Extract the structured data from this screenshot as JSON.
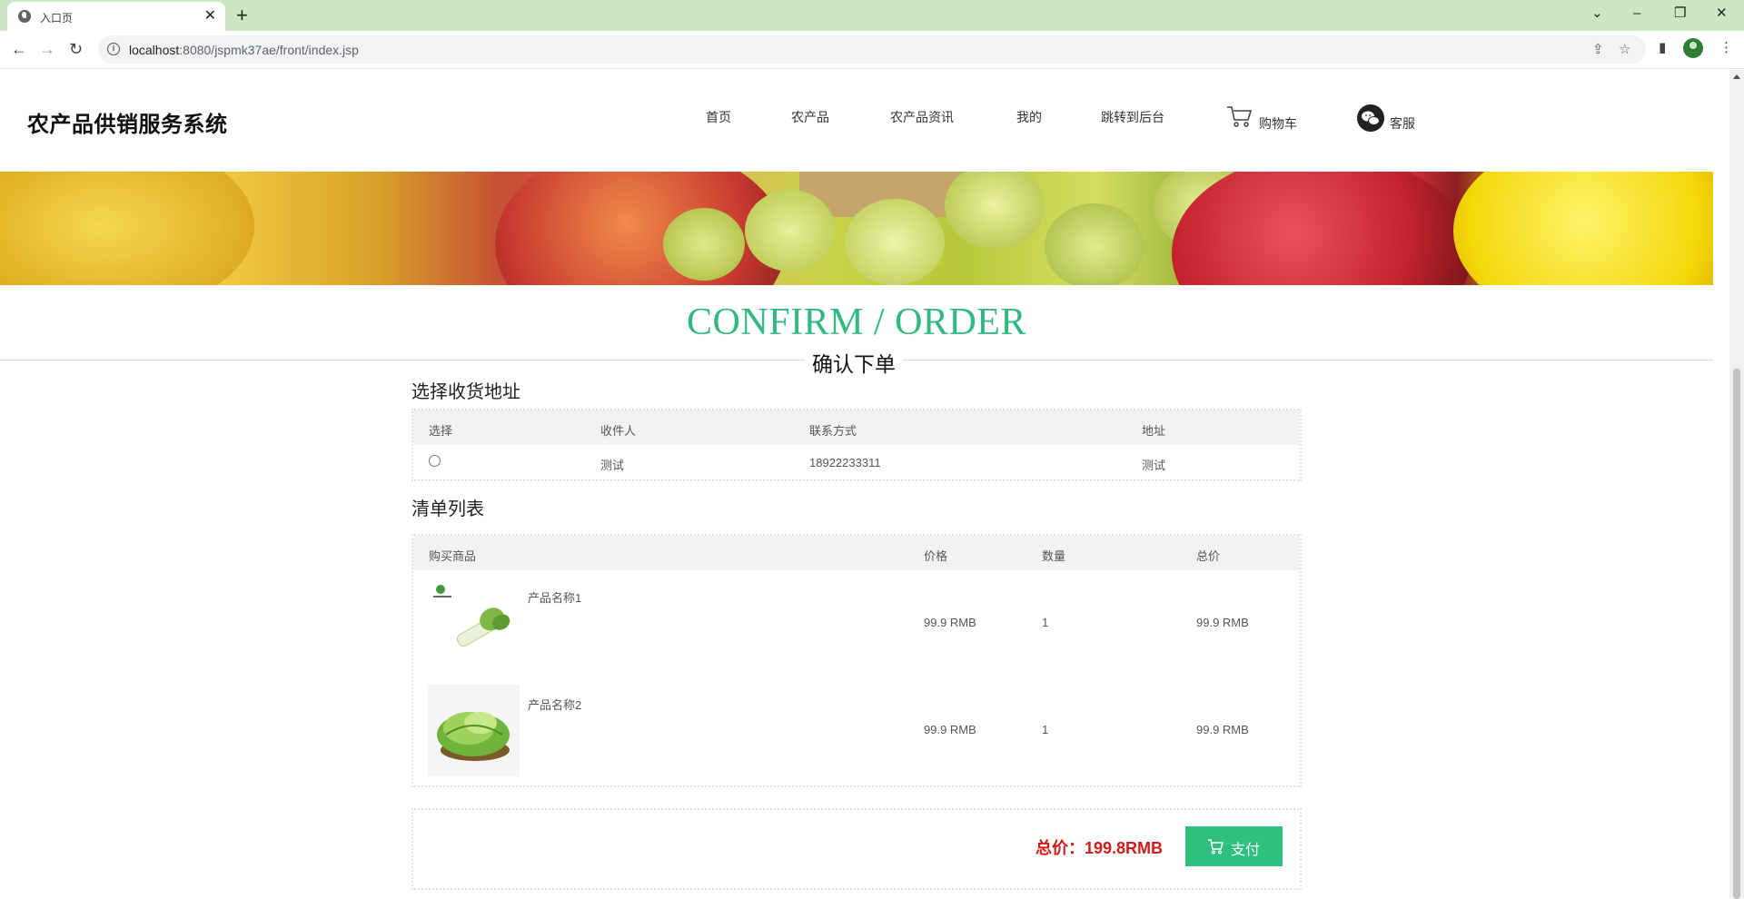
{
  "browser": {
    "tab_title": "入口页",
    "url_host": "localhost",
    "url_path": ":8080/jspmk37ae/front/index.jsp"
  },
  "header": {
    "site_title": "农产品供销服务系统",
    "nav": [
      "首页",
      "农产品",
      "农产品资讯",
      "我的",
      "跳转到后台"
    ],
    "cart_label": "购物车",
    "service_label": "客服"
  },
  "page": {
    "heading_en": "CONFIRM / ORDER",
    "heading_cn": "确认下单"
  },
  "address": {
    "title": "选择收货地址",
    "columns": [
      "选择",
      "收件人",
      "联系方式",
      "地址"
    ],
    "rows": [
      {
        "selected": false,
        "recipient": "测试",
        "phone": "18922233311",
        "address": "测试"
      }
    ]
  },
  "items": {
    "title": "清单列表",
    "columns": [
      "购买商品",
      "价格",
      "数量",
      "总价"
    ],
    "rows": [
      {
        "name": "产品名称1",
        "price": "99.9 RMB",
        "qty": "1",
        "total": "99.9 RMB",
        "image": "celery-icon"
      },
      {
        "name": "产品名称2",
        "price": "99.9 RMB",
        "qty": "1",
        "total": "99.9 RMB",
        "image": "lettuce-icon"
      }
    ]
  },
  "summary": {
    "total_label": "总价：199.8RMB",
    "pay_label": "支付"
  },
  "colors": {
    "accent": "#2fbf7f",
    "heading_green": "#33b880",
    "price_red": "#d11a1a",
    "tabbar": "#cce8c2"
  }
}
